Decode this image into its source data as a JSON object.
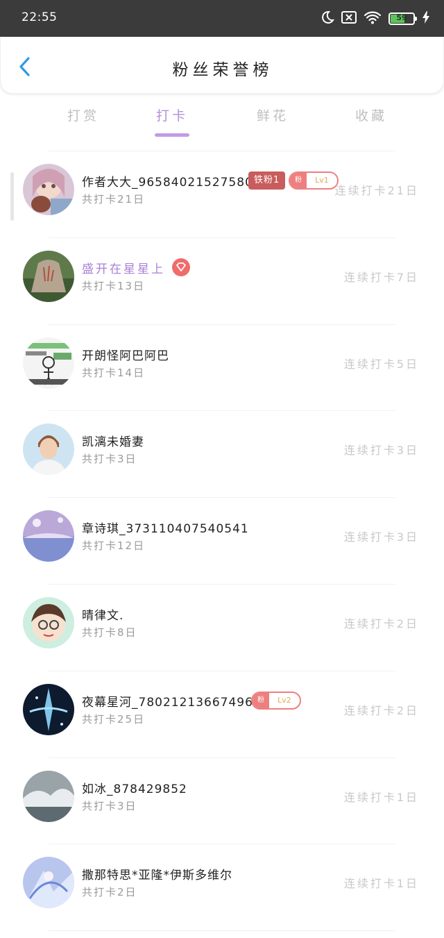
{
  "status_bar": {
    "time": "22:55",
    "battery": "59"
  },
  "header": {
    "title": "粉丝荣誉榜"
  },
  "tabs": [
    {
      "label": "打赏"
    },
    {
      "label": "打卡"
    },
    {
      "label": "鲜花"
    },
    {
      "label": "收藏"
    }
  ],
  "active_tab": "打卡",
  "list": [
    {
      "name": "作者大大_965840215275800",
      "total": "共打卡21日",
      "streak": "连续打卡21日",
      "tie_badge": "铁粉1",
      "fan_badge": {
        "label": "粉",
        "level": "Lv1"
      }
    },
    {
      "name": "盛开在星星上",
      "total": "共打卡13日",
      "streak": "连续打卡7日",
      "vip": true
    },
    {
      "name": "开朗怪阿巴阿巴",
      "total": "共打卡14日",
      "streak": "连续打卡5日"
    },
    {
      "name": "凯漓未婚妻",
      "total": "共打卡3日",
      "streak": "连续打卡3日"
    },
    {
      "name": "章诗琪_373110407540541",
      "total": "共打卡12日",
      "streak": "连续打卡3日"
    },
    {
      "name": "晴律文.",
      "total": "共打卡8日",
      "streak": "连续打卡2日"
    },
    {
      "name": "夜幕星河_780212136674969",
      "total": "共打卡25日",
      "streak": "连续打卡2日",
      "fan_badge": {
        "label": "粉",
        "level": "Lv2"
      }
    },
    {
      "name": "如冰_878429852",
      "total": "共打卡3日",
      "streak": "连续打卡1日"
    },
    {
      "name": "撒那特思*亚隆*伊斯多维尔",
      "total": "共打卡2日",
      "streak": "连续打卡1日"
    }
  ]
}
